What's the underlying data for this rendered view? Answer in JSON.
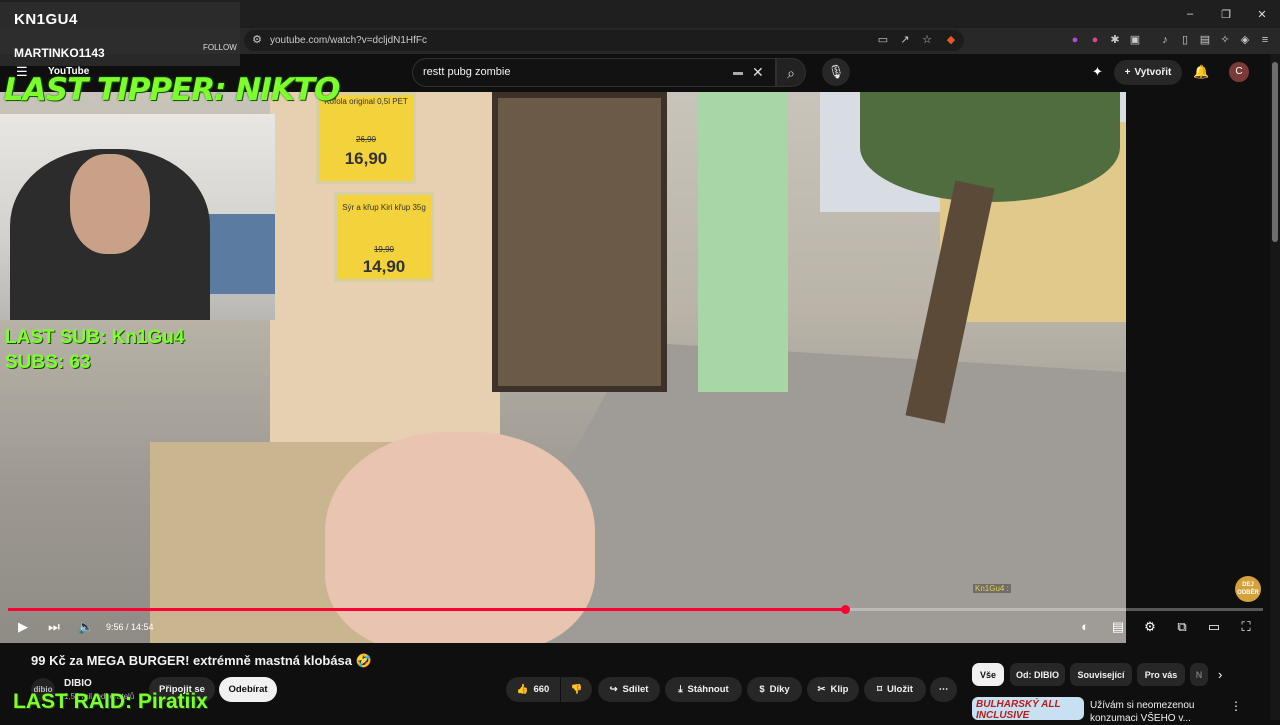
{
  "browser": {
    "url": "youtube.com/watch?v=dcljdN1HfFc",
    "window_controls": [
      "–",
      "❐",
      "✕"
    ]
  },
  "youtube": {
    "logo": "YouTube",
    "search_query": "restt pubg zombie",
    "create_label": "Vytvořit",
    "avatar_letter": "C"
  },
  "video": {
    "time_current": "9:56",
    "time_total": "14:54",
    "time_display": "9:56 / 14:54",
    "progress": 0.667,
    "sign1_price": "16,90",
    "sign1_old": "26,90",
    "sign1_text": "Kofola original 0,5l PET",
    "sign2_text": "Sýr a křup Kiri křup 35g",
    "sign2_old": "19,90",
    "sign2_price": "14,90",
    "chat_tag": "Kn1Gu4 :",
    "end_logo": "DEJ ODBĚR"
  },
  "below": {
    "title": "99 Kč za MEGA BURGER! extrémně mastná klobása 🤣",
    "channel_name": "DIBIO",
    "channel_avatar": "dibio",
    "subs_text": "1,53 mil. odběratelů",
    "join_label": "Připojit se",
    "subscribe_label": "Odebírat",
    "like_count": "660",
    "share_label": "Sdílet",
    "download_label": "Stáhnout",
    "thanks_label": "Díky",
    "clip_label": "Klip",
    "save_label": "Uložit",
    "more_label": "⋯"
  },
  "chips": [
    "Vše",
    "Od: DIBIO",
    "Související",
    "Pro vás",
    "N"
  ],
  "recommendation": {
    "thumb_text": "BULHARSKÝ ALL INCLUSIVE",
    "title": "Užívám si neomezenou konzumaci VŠEHO v..."
  },
  "overlay": {
    "streamer_name": "KN1GU4",
    "follower_name": "MARTINKO1143",
    "follow_label": "FOLLOW",
    "last_tipper": "LAST TIPPER: NIKTO",
    "last_sub": "LAST SUB: Kn1Gu4",
    "subs": "SUBS: 63",
    "last_raid": "LAST RAID: Piratiix"
  },
  "colors": {
    "progress_red": "#ff0033",
    "neon_green": "#7dff2e",
    "background": "#0f0f0f"
  },
  "icons": {
    "play": "▶",
    "next": "⏭",
    "volume": "🔈",
    "autoplay": "toggle",
    "subtitles": "▤",
    "settings": "⚙",
    "miniplayer": "⧉",
    "theater": "▭",
    "fullscreen": "⛶"
  }
}
